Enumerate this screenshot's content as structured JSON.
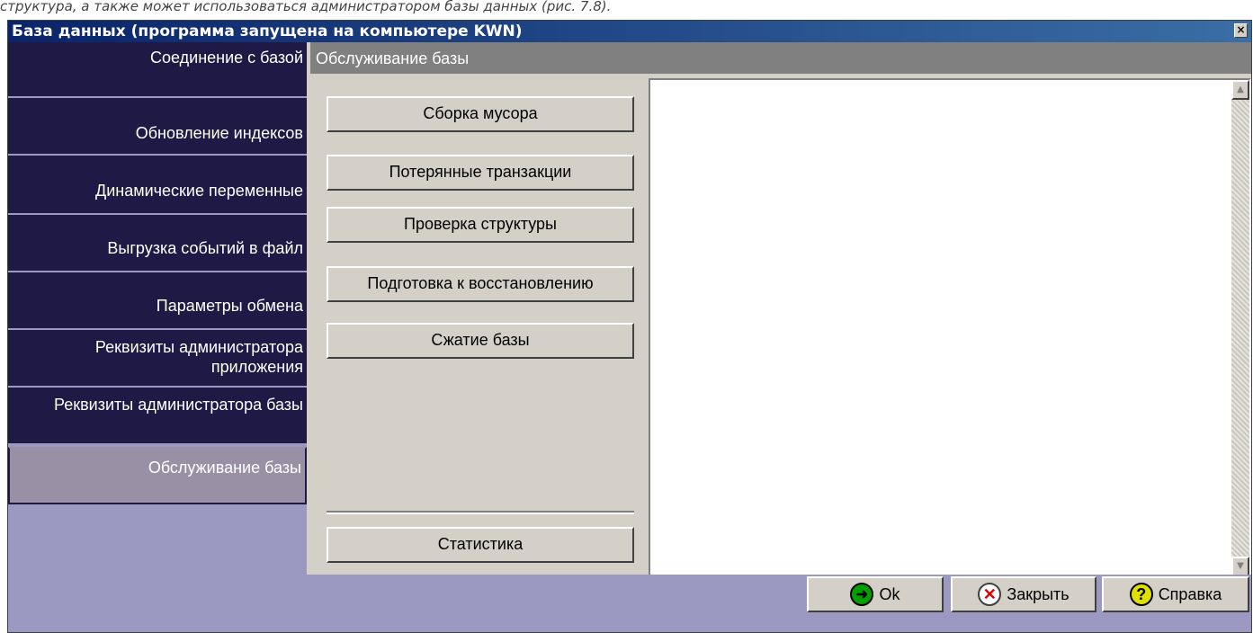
{
  "doc_text": "структура, а также может использоваться администратором базы данных (рис. 7.8).",
  "window": {
    "title": "База данных (программа запущена на компьютере  KWN)",
    "close_glyph": "×"
  },
  "sidebar": {
    "items": [
      {
        "label": "Соединение с базой"
      },
      {
        "label": "Обновление индексов"
      },
      {
        "label": "Динамические переменные"
      },
      {
        "label": "Выгрузка событий в файл"
      },
      {
        "label": "Параметры обмена"
      },
      {
        "label": "Реквизиты администратора приложения"
      },
      {
        "label": "Реквизиты администратора базы"
      },
      {
        "label": "Обслуживание базы"
      }
    ],
    "active_index": 7
  },
  "panel": {
    "title": "Обслуживание базы",
    "buttons": [
      {
        "label": "Сборка мусора"
      },
      {
        "label": "Потерянные транзакции"
      },
      {
        "label": "Проверка структуры"
      },
      {
        "label": "Подготовка к восстановлению"
      },
      {
        "label": "Сжатие базы"
      }
    ],
    "stats_label": "Статистика"
  },
  "footer": {
    "ok": {
      "label": "Ok",
      "icon": "arrow-right-icon",
      "color": "#00a000"
    },
    "close": {
      "label": "Закрыть",
      "icon": "x-circle-icon",
      "color": "#e00000"
    },
    "help": {
      "label": "Справка",
      "icon": "question-circle-icon",
      "color": "#e0e000"
    }
  },
  "colors": {
    "title_start": "#0a246a",
    "title_end": "#3a6ea5",
    "sidebar_dark": "#1f1a45",
    "sidebar_bg": "#9b99c2",
    "active_item": "#9a90a6"
  }
}
